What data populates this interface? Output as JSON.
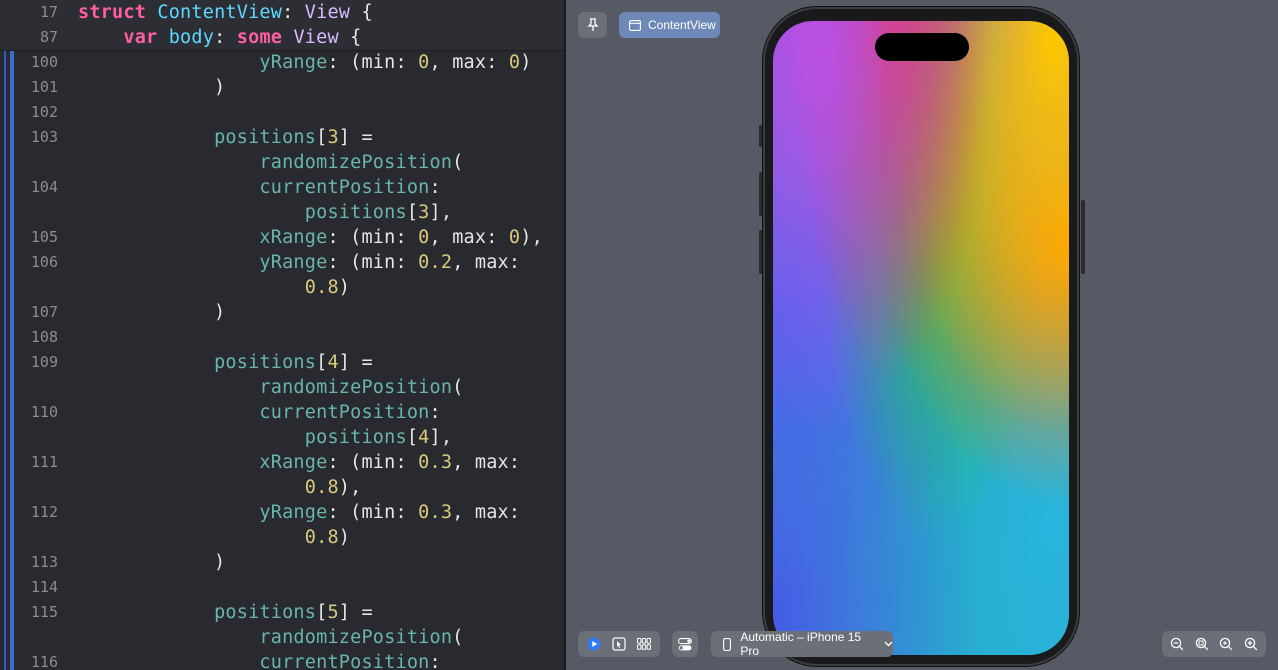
{
  "editor": {
    "sticky_headers": [
      {
        "ln": "17",
        "tokens": [
          [
            "kw",
            "struct"
          ],
          [
            "pl",
            " "
          ],
          [
            "tx",
            "ContentView"
          ],
          [
            "pl",
            ": "
          ],
          [
            "ty",
            "View"
          ],
          [
            "pl",
            " {"
          ]
        ]
      },
      {
        "ln": "87",
        "tokens": [
          [
            "pl",
            "    "
          ],
          [
            "kw",
            "var"
          ],
          [
            "pl",
            " "
          ],
          [
            "tx",
            "body"
          ],
          [
            "pl",
            ": "
          ],
          [
            "kw",
            "some"
          ],
          [
            "pl",
            " "
          ],
          [
            "ty",
            "View"
          ],
          [
            "pl",
            " {"
          ]
        ]
      }
    ],
    "lines": [
      {
        "ln": "100",
        "tokens": [
          [
            "pl",
            "                "
          ],
          [
            "fn",
            "yRange"
          ],
          [
            "pl",
            ": (min: "
          ],
          [
            "nm",
            "0"
          ],
          [
            "pl",
            ", max: "
          ],
          [
            "nm",
            "0"
          ],
          [
            "pl",
            ")"
          ]
        ]
      },
      {
        "ln": "101",
        "tokens": [
          [
            "pl",
            "            )"
          ]
        ]
      },
      {
        "ln": "102",
        "tokens": []
      },
      {
        "ln": "103",
        "tokens": [
          [
            "pl",
            "            "
          ],
          [
            "fn",
            "positions"
          ],
          [
            "pl",
            "["
          ],
          [
            "nm",
            "3"
          ],
          [
            "pl",
            "] ="
          ]
        ]
      },
      {
        "ln": "",
        "tokens": [
          [
            "pl",
            "                "
          ],
          [
            "fn",
            "randomizePosition"
          ],
          [
            "pl",
            "("
          ]
        ]
      },
      {
        "ln": "104",
        "tokens": [
          [
            "pl",
            "                "
          ],
          [
            "fn",
            "currentPosition"
          ],
          [
            "pl",
            ":"
          ]
        ]
      },
      {
        "ln": "",
        "tokens": [
          [
            "pl",
            "                    "
          ],
          [
            "fn",
            "positions"
          ],
          [
            "pl",
            "["
          ],
          [
            "nm",
            "3"
          ],
          [
            "pl",
            "],"
          ]
        ]
      },
      {
        "ln": "105",
        "tokens": [
          [
            "pl",
            "                "
          ],
          [
            "fn",
            "xRange"
          ],
          [
            "pl",
            ": (min: "
          ],
          [
            "nm",
            "0"
          ],
          [
            "pl",
            ", max: "
          ],
          [
            "nm",
            "0"
          ],
          [
            "pl",
            "),"
          ]
        ]
      },
      {
        "ln": "106",
        "tokens": [
          [
            "pl",
            "                "
          ],
          [
            "fn",
            "yRange"
          ],
          [
            "pl",
            ": (min: "
          ],
          [
            "nm",
            "0.2"
          ],
          [
            "pl",
            ", max:"
          ]
        ]
      },
      {
        "ln": "",
        "tokens": [
          [
            "pl",
            "                    "
          ],
          [
            "nm",
            "0.8"
          ],
          [
            "pl",
            ")"
          ]
        ]
      },
      {
        "ln": "107",
        "tokens": [
          [
            "pl",
            "            )"
          ]
        ]
      },
      {
        "ln": "108",
        "tokens": []
      },
      {
        "ln": "109",
        "tokens": [
          [
            "pl",
            "            "
          ],
          [
            "fn",
            "positions"
          ],
          [
            "pl",
            "["
          ],
          [
            "nm",
            "4"
          ],
          [
            "pl",
            "] ="
          ]
        ]
      },
      {
        "ln": "",
        "tokens": [
          [
            "pl",
            "                "
          ],
          [
            "fn",
            "randomizePosition"
          ],
          [
            "pl",
            "("
          ]
        ]
      },
      {
        "ln": "110",
        "tokens": [
          [
            "pl",
            "                "
          ],
          [
            "fn",
            "currentPosition"
          ],
          [
            "pl",
            ":"
          ]
        ]
      },
      {
        "ln": "",
        "tokens": [
          [
            "pl",
            "                    "
          ],
          [
            "fn",
            "positions"
          ],
          [
            "pl",
            "["
          ],
          [
            "nm",
            "4"
          ],
          [
            "pl",
            "],"
          ]
        ]
      },
      {
        "ln": "111",
        "tokens": [
          [
            "pl",
            "                "
          ],
          [
            "fn",
            "xRange"
          ],
          [
            "pl",
            ": (min: "
          ],
          [
            "nm",
            "0.3"
          ],
          [
            "pl",
            ", max:"
          ]
        ]
      },
      {
        "ln": "",
        "tokens": [
          [
            "pl",
            "                    "
          ],
          [
            "nm",
            "0.8"
          ],
          [
            "pl",
            "),"
          ]
        ]
      },
      {
        "ln": "112",
        "tokens": [
          [
            "pl",
            "                "
          ],
          [
            "fn",
            "yRange"
          ],
          [
            "pl",
            ": (min: "
          ],
          [
            "nm",
            "0.3"
          ],
          [
            "pl",
            ", max:"
          ]
        ]
      },
      {
        "ln": "",
        "tokens": [
          [
            "pl",
            "                    "
          ],
          [
            "nm",
            "0.8"
          ],
          [
            "pl",
            ")"
          ]
        ]
      },
      {
        "ln": "113",
        "tokens": [
          [
            "pl",
            "            )"
          ]
        ]
      },
      {
        "ln": "114",
        "tokens": []
      },
      {
        "ln": "115",
        "tokens": [
          [
            "pl",
            "            "
          ],
          [
            "fn",
            "positions"
          ],
          [
            "pl",
            "["
          ],
          [
            "nm",
            "5"
          ],
          [
            "pl",
            "] ="
          ]
        ]
      },
      {
        "ln": "",
        "tokens": [
          [
            "pl",
            "                "
          ],
          [
            "fn",
            "randomizePosition"
          ],
          [
            "pl",
            "("
          ]
        ]
      },
      {
        "ln": "116",
        "tokens": [
          [
            "pl",
            "                "
          ],
          [
            "fn",
            "currentPosition"
          ],
          [
            "pl",
            ":"
          ]
        ]
      }
    ]
  },
  "canvas": {
    "pin_icon": "pin-icon",
    "preview_chip_label": "ContentView",
    "preview_chip_icon": "window-icon",
    "device_label": "Automatic – iPhone 15 Pro",
    "device_icon": "iphone-icon",
    "device_chevron": "chevron-down-icon",
    "left_controls": [
      "live-play-icon",
      "selectable-cursor-icon",
      "grid-variants-icon"
    ],
    "device_settings_icon": "device-settings-icon",
    "zoom_controls": [
      "zoom-out-icon",
      "zoom-fit-icon",
      "zoom-100-icon",
      "zoom-in-icon"
    ]
  },
  "colors": {
    "keyword": "#fc5fa3",
    "type": "#dabaff",
    "number": "#d9c97c",
    "identifier": "#67b7a4",
    "declaration": "#5dd8ff",
    "editor_bg": "#292a30",
    "canvas_bg": "#555a64",
    "accent": "#6e89b8"
  }
}
